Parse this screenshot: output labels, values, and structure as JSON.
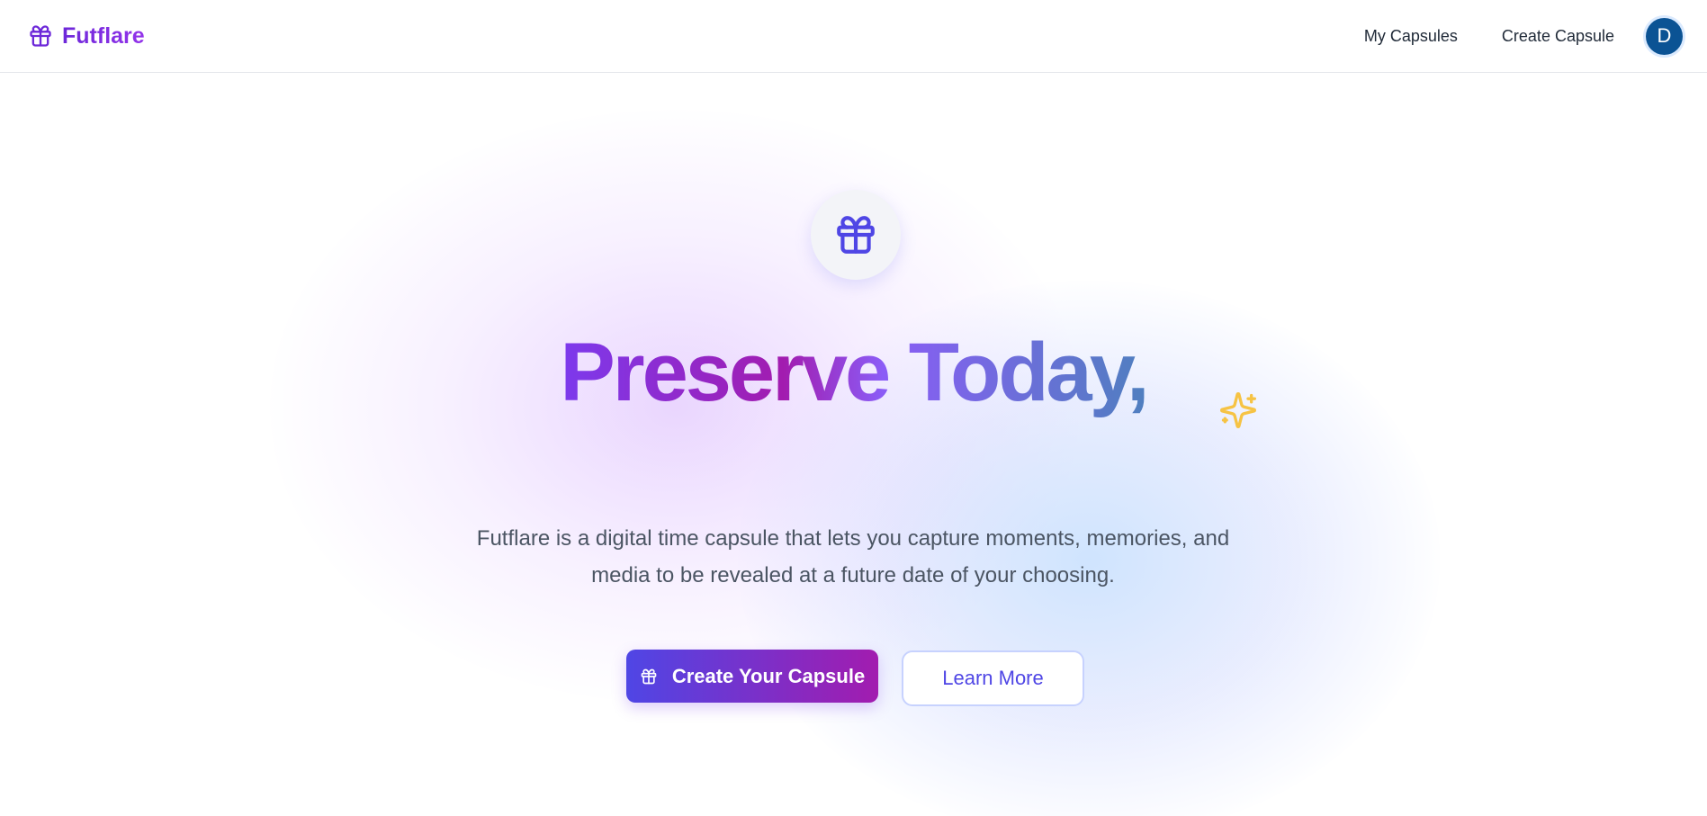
{
  "brand": {
    "name": "Futflare",
    "icon": "gift-icon"
  },
  "nav": {
    "links": [
      "My Capsules",
      "Create Capsule"
    ],
    "avatar_initial": "D"
  },
  "hero": {
    "icon": "gift-icon",
    "title": "Preserve Today,",
    "decoration_icon": "sparkles-icon",
    "description": "Futflare is a digital time capsule that lets you capture moments, memories, and media to be revealed at a future date of your choosing.",
    "primary_button": "Create Your Capsule",
    "secondary_button": "Learn More"
  },
  "colors": {
    "brand": "#7c3aed",
    "accent_indigo": "#4f46e5",
    "avatar_bg": "#0b5394",
    "sparkle": "#f6c344"
  }
}
